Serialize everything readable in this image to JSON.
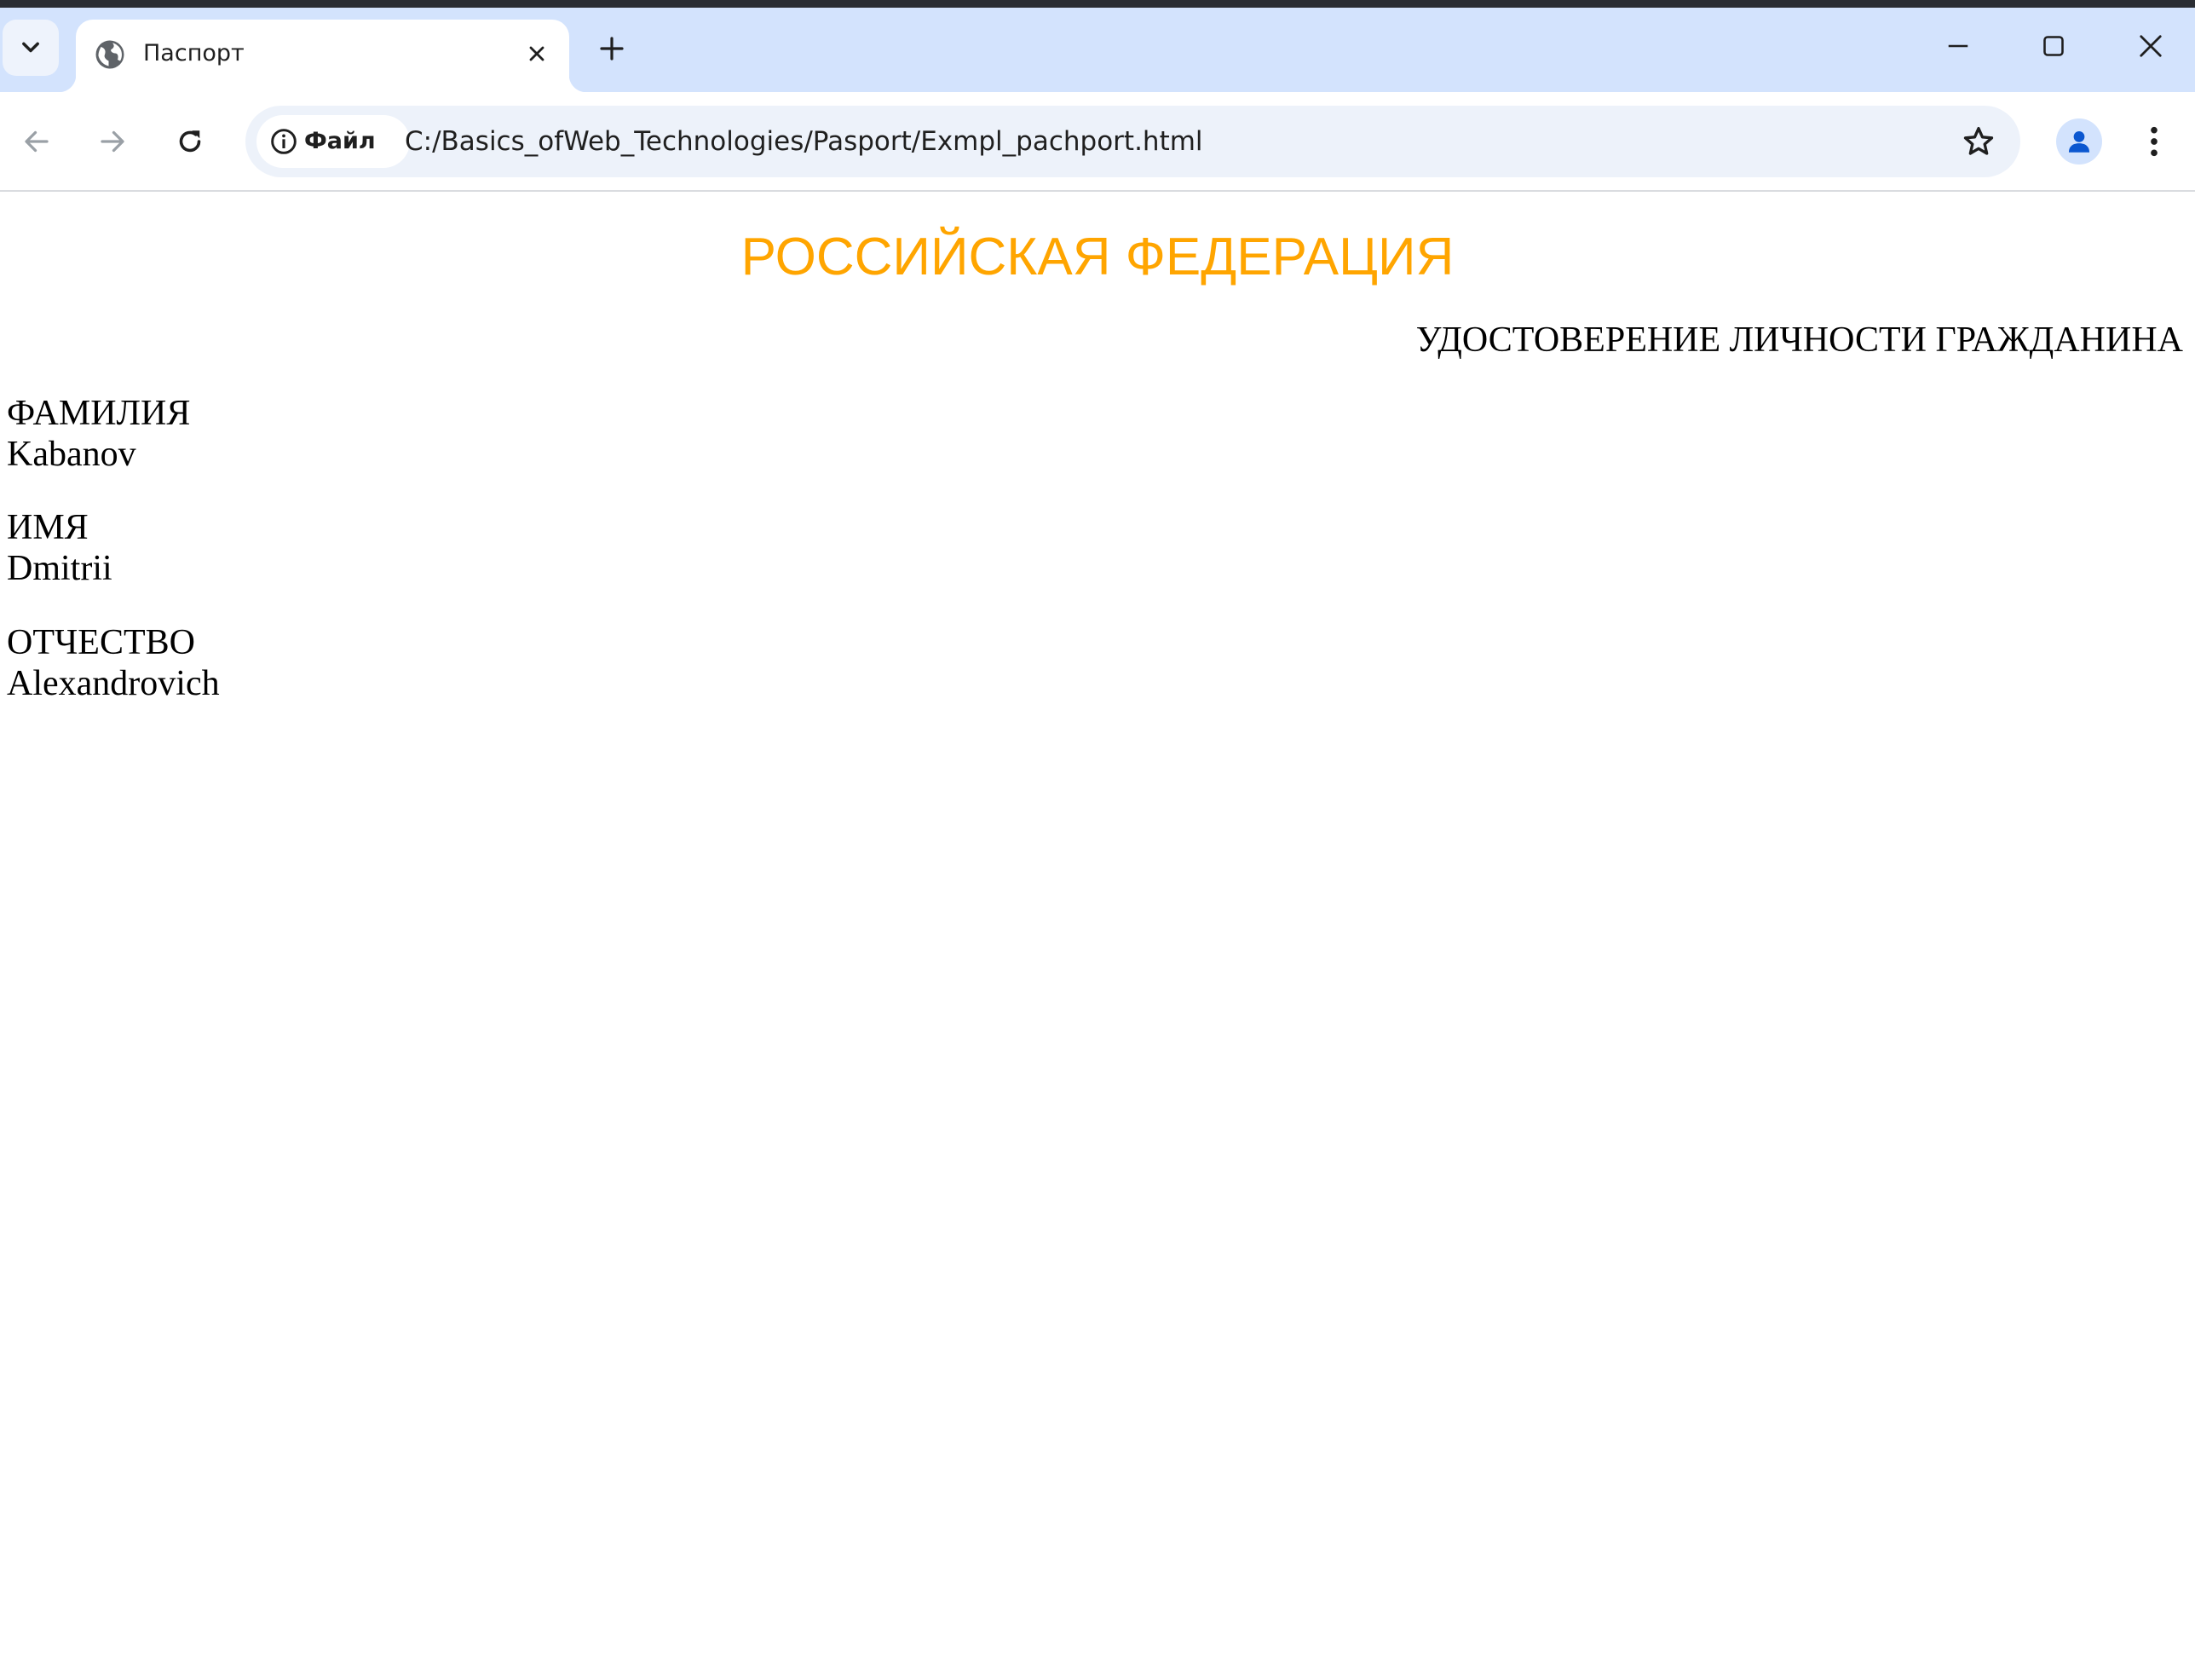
{
  "browser": {
    "tab": {
      "title": "Паспорт"
    },
    "address_bar": {
      "site_chip_label": "Файл",
      "url": "C:/Basics_ofWeb_Technologies/Pasport/Exmpl_pachport.html"
    }
  },
  "page": {
    "heading": "РОССИЙСКАЯ ФЕДЕРАЦИЯ",
    "heading_color": "#ffa500",
    "subheading": "УДОСТОВЕРЕНИЕ ЛИЧНОСТИ ГРАЖДАНИНА",
    "fields": [
      {
        "label": "ФАМИЛИЯ",
        "value": "Kabanov"
      },
      {
        "label": "ИМЯ",
        "value": "Dmitrii"
      },
      {
        "label": "ОТЧЕСТВО",
        "value": "Alexandrovich"
      }
    ]
  },
  "icons": {
    "tab_search": "chevron-down-icon",
    "favicon": "globe-icon",
    "tab_close": "close-icon",
    "new_tab": "plus-icon",
    "minimize": "minimize-icon",
    "maximize": "maximize-icon",
    "close_window": "close-icon",
    "back": "arrow-left-icon",
    "forward": "arrow-right-icon",
    "reload": "reload-icon",
    "site_info": "info-icon",
    "bookmark": "star-icon",
    "profile": "person-icon",
    "menu": "kebab-menu-icon"
  }
}
